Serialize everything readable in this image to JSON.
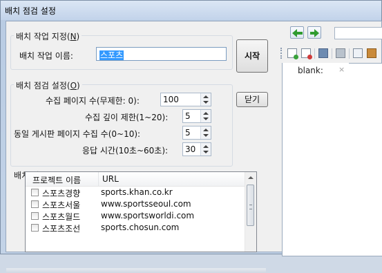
{
  "window": {
    "title": "배치 점검 설정"
  },
  "job_spec": {
    "group_label": "배치 작업 지정(N)",
    "name_label": "배치 작업 이름:",
    "name_value": "스포츠"
  },
  "settings": {
    "group_label": "배치 점검 설정(O)",
    "fields": [
      {
        "label": "수집 페이지 수(무제한: 0):",
        "value": "100"
      },
      {
        "label": "수집 깊이 제한(1~20):",
        "value": "5"
      },
      {
        "label": "동일 게시판 페이지 수집 수(0~10):",
        "value": "5"
      },
      {
        "label": "응답 시간(10초~60초):",
        "value": "30"
      }
    ]
  },
  "buttons": {
    "start": "시작",
    "close": "닫기"
  },
  "job_list": {
    "group_label": "배치 작업 목록(L)",
    "columns": [
      "프로젝트 이름",
      "URL"
    ],
    "rows": [
      {
        "name": "스포츠경향",
        "url": "sports.khan.co.kr",
        "checked": false
      },
      {
        "name": "스포츠서울",
        "url": "www.sportsseoul.com",
        "checked": false
      },
      {
        "name": "스포츠월드",
        "url": "www.sportsworldi.com",
        "checked": false
      },
      {
        "name": "스포츠조선",
        "url": "sports.chosun.com",
        "checked": false
      }
    ]
  },
  "browser": {
    "back_icon": "arrow-left-icon",
    "forward_icon": "arrow-right-icon",
    "tab_label": "blank:",
    "tab_close": "×"
  }
}
